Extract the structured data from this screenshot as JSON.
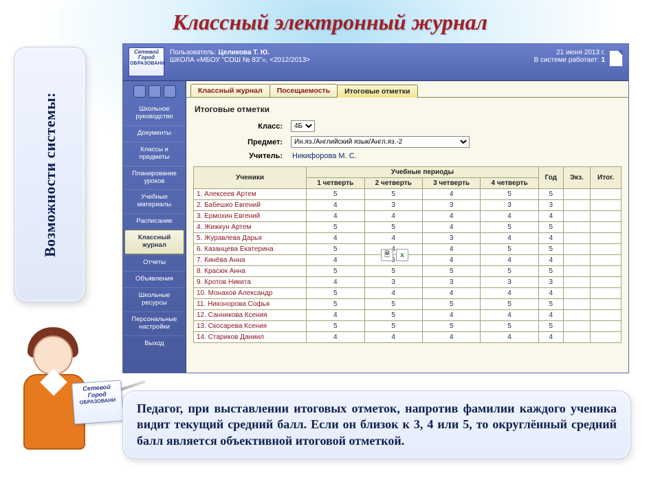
{
  "slide": {
    "title": "Классный электронный журнал",
    "sidebar_label": "Возможности системы:",
    "callout": "Педагог, при выставлении итоговых отметок, напротив фамилии каждого ученика видит текущий средний балл. Если он близок к 3, 4 или 5, то округлённый средний балл является объективной итоговой отметкой."
  },
  "logo": {
    "line1": "Сетевой",
    "line2": "Город",
    "line3": "ОБРАЗОВАНИ"
  },
  "header": {
    "user_label": "Пользователь:",
    "user_name": "Целикова Т. Ю.",
    "school": "ШКОЛА «МБОУ \"СОШ № 83\"»,  <2012/2013>",
    "date": "21 июня 2013 г.",
    "online_label": "В системе работает:",
    "online_count": "1"
  },
  "nav": {
    "items": [
      "Школьное руководство",
      "Документы",
      "Классы и предметы",
      "Планирование уроков",
      "Учебные материалы",
      "Расписание",
      "Классный журнал",
      "Отчеты",
      "Объявления",
      "Школьные ресурсы",
      "Персональные настройки",
      "Выход"
    ],
    "active_index": 6
  },
  "tabs": {
    "items": [
      "Классный журнал",
      "Посещаемость",
      "Итоговые отметки"
    ],
    "active_index": 2
  },
  "page": {
    "heading": "Итоговые отметки",
    "class_label": "Класс:",
    "class_value": "4Б",
    "subject_label": "Предмет:",
    "subject_value": "Ин.яз./Английский язык/Англ.яз.-2",
    "teacher_label": "Учитель:",
    "teacher_name": "Никифорова М. С."
  },
  "table": {
    "col_students": "Ученики",
    "col_periods": "Учебные периоды",
    "periods": [
      "1 четверть",
      "2 четверть",
      "3 четверть",
      "4 четверть"
    ],
    "col_year": "Год",
    "col_exam": "Экз.",
    "col_final": "Итог.",
    "rows": [
      {
        "n": "1.",
        "name": "Алексеев Артем",
        "g": [
          "5",
          "5",
          "4",
          "5",
          "5",
          "",
          ""
        ]
      },
      {
        "n": "2.",
        "name": "Бабешко Евгений",
        "g": [
          "4",
          "3",
          "3",
          "3",
          "3",
          "",
          ""
        ]
      },
      {
        "n": "3.",
        "name": "Ермохин Евгений",
        "g": [
          "4",
          "4",
          "4",
          "4",
          "4",
          "",
          ""
        ]
      },
      {
        "n": "4.",
        "name": "Жижкун Артем",
        "g": [
          "5",
          "5",
          "4",
          "5",
          "5",
          "",
          ""
        ]
      },
      {
        "n": "5.",
        "name": "Журавлева Дарья",
        "g": [
          "4",
          "4",
          "3",
          "4",
          "4",
          "",
          ""
        ]
      },
      {
        "n": "6.",
        "name": "Казанцева Екатерина",
        "g": [
          "5",
          "4",
          "4",
          "5",
          "5",
          "",
          ""
        ]
      },
      {
        "n": "7.",
        "name": "Кинёва Анна",
        "g": [
          "4",
          "5",
          "4",
          "4",
          "4",
          "",
          ""
        ]
      },
      {
        "n": "8.",
        "name": "Красюк Анна",
        "g": [
          "5",
          "5",
          "5",
          "5",
          "5",
          "",
          ""
        ]
      },
      {
        "n": "9.",
        "name": "Кротов Никита",
        "g": [
          "4",
          "3",
          "3",
          "3",
          "3",
          "",
          ""
        ]
      },
      {
        "n": "10.",
        "name": "Монахов Александр",
        "g": [
          "5",
          "4",
          "4",
          "4",
          "4",
          "",
          ""
        ]
      },
      {
        "n": "11.",
        "name": "Никонорова Софья",
        "g": [
          "5",
          "5",
          "5",
          "5",
          "5",
          "",
          ""
        ]
      },
      {
        "n": "12.",
        "name": "Санникова Ксения",
        "g": [
          "4",
          "5",
          "4",
          "4",
          "4",
          "",
          ""
        ]
      },
      {
        "n": "13.",
        "name": "Скосарева Ксения",
        "g": [
          "5",
          "5",
          "5",
          "5",
          "5",
          "",
          ""
        ]
      },
      {
        "n": "14.",
        "name": "Стариков Даниил",
        "g": [
          "4",
          "4",
          "4",
          "4",
          "4",
          "",
          ""
        ]
      }
    ]
  }
}
